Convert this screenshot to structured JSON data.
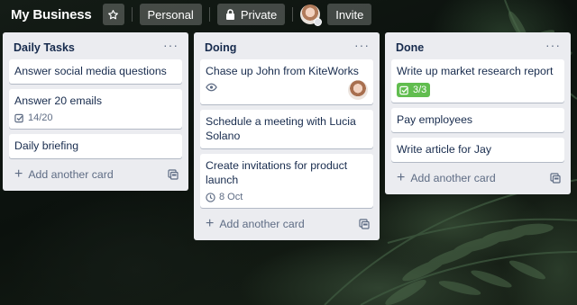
{
  "header": {
    "board_title": "My Business",
    "star_icon": "star-icon",
    "workspace_label": "Personal",
    "visibility_label": "Private",
    "invite_label": "Invite"
  },
  "lists": [
    {
      "title": "Daily Tasks",
      "menu": "···",
      "cards": [
        {
          "title": "Answer social media questions"
        },
        {
          "title": "Answer 20 emails",
          "checklist": "14/20"
        },
        {
          "title": "Daily briefing"
        }
      ],
      "add_label": "Add another card"
    },
    {
      "title": "Doing",
      "menu": "···",
      "cards": [
        {
          "title": "Chase up John from KiteWorks",
          "watching": true,
          "has_member": true
        },
        {
          "title": "Schedule a meeting with Lucia Solano"
        },
        {
          "title": "Create invitations for product launch",
          "due": "8 Oct"
        }
      ],
      "add_label": "Add another card"
    },
    {
      "title": "Done",
      "menu": "···",
      "cards": [
        {
          "title": "Write up market research report",
          "checklist_done": "3/3"
        },
        {
          "title": "Pay employees"
        },
        {
          "title": "Write article for Jay"
        }
      ],
      "add_label": "Add another card"
    }
  ],
  "colors": {
    "list_bg": "#ebecf0",
    "card_text": "#172b4d",
    "muted": "#5e6c84",
    "checklist_complete": "#61bd4f"
  }
}
